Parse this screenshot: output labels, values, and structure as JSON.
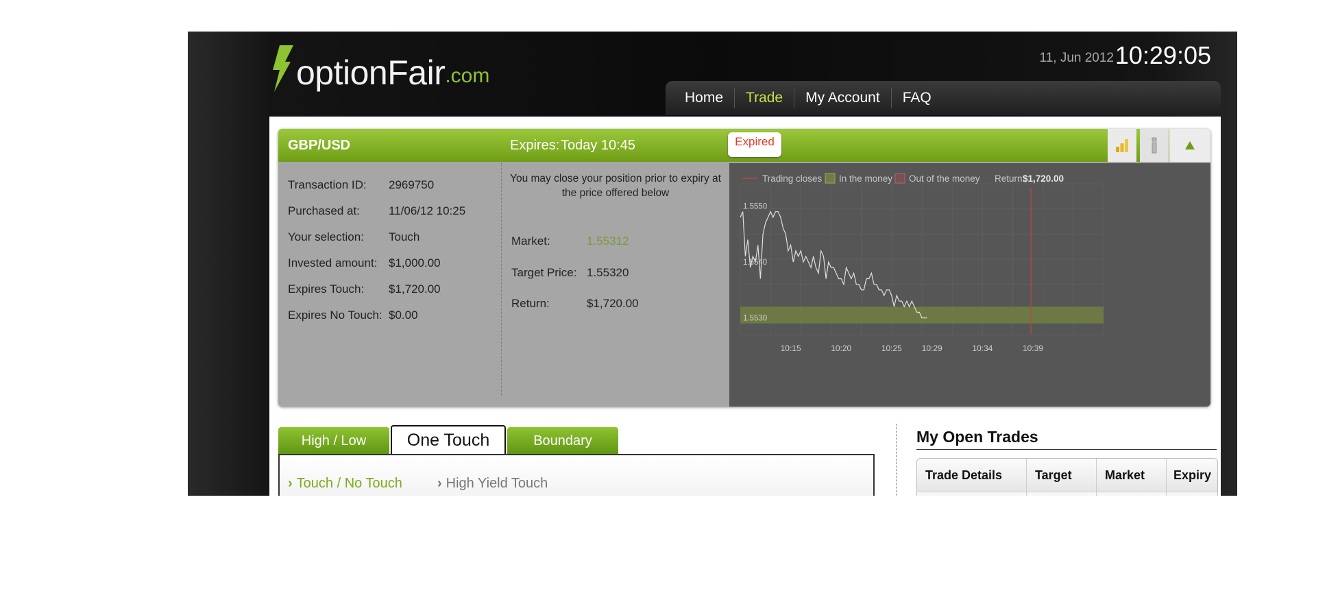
{
  "brand": {
    "logo_main": "optionFair",
    "logo_suffix": ".com",
    "accent": "#8ec332"
  },
  "header": {
    "date": "11, Jun 2012",
    "time": "10:29:05"
  },
  "nav": {
    "items": [
      "Home",
      "Trade",
      "My Account",
      "FAQ"
    ],
    "active": "Trade",
    "active_color": "#c4e04a"
  },
  "trade": {
    "asset": "GBP/USD",
    "expires_label": "Expires:",
    "expires_value": "Today 10:45",
    "status_badge": "Expired",
    "details": [
      {
        "label": "Transaction ID:",
        "value": "2969750"
      },
      {
        "label": "Purchased at:",
        "value": "11/06/12 10:25"
      },
      {
        "label": "Your selection:",
        "value": "Touch"
      },
      {
        "label": "Invested amount:",
        "value": "$1,000.00"
      },
      {
        "label": "Expires Touch:",
        "value": "$1,720.00"
      },
      {
        "label": "Expires No Touch:",
        "value": "$0.00"
      }
    ],
    "close_message": "You may close your position prior to expiry at the price offered below",
    "market_label": "Market:",
    "market_value": "1.55312",
    "target_label": "Target Price:",
    "target_value": "1.55320",
    "return_label": "Return:",
    "return_value": "$1,720.00"
  },
  "chart_data": {
    "type": "line",
    "legend": [
      "Trading closes",
      "In the money",
      "Out of the money"
    ],
    "return_label": "Return:",
    "return_value": "$1,720.00",
    "y_ticks": [
      "1.5550",
      "1.5540",
      "1.5530"
    ],
    "x_ticks": [
      "10:15",
      "10:20",
      "10:25",
      "10:29",
      "10:34",
      "10:39"
    ],
    "x_minutes": [
      15,
      20,
      25,
      29,
      34,
      39
    ],
    "ylim": [
      1.5527,
      1.5554
    ],
    "xlim": [
      10,
      46
    ],
    "band_range": [
      1.5529,
      1.5532
    ],
    "trading_closes_minute": 38.8,
    "series": [
      {
        "x": [
          10.0,
          10.25,
          10.5,
          10.75,
          11.0,
          11.25,
          11.5,
          11.75,
          12.0,
          12.25,
          12.5,
          12.75,
          13.0,
          13.25,
          13.5,
          13.75,
          14.0,
          14.25,
          14.5,
          14.75,
          15.0,
          15.25,
          15.5,
          15.75,
          16.0,
          16.25,
          16.5,
          16.75,
          17.0,
          17.25,
          17.5,
          17.75,
          18.0,
          18.25,
          18.5,
          18.75,
          19.0,
          19.25,
          19.5,
          19.75,
          20.0,
          20.25,
          20.5,
          20.75,
          21.0,
          21.25,
          21.5,
          21.75,
          22.0,
          22.25,
          22.5,
          22.75,
          23.0,
          23.25,
          23.5,
          23.75,
          24.0,
          24.25,
          24.5,
          24.75,
          25.0,
          25.25,
          25.5,
          25.75,
          26.0,
          26.25,
          26.5,
          26.75,
          27.0,
          27.25,
          27.5,
          27.75,
          28.0,
          28.25,
          28.5
        ],
        "y": [
          1.5548,
          1.5549,
          1.5541,
          1.5544,
          1.5539,
          1.5541,
          1.554,
          1.5543,
          1.5537,
          1.5545,
          1.5547,
          1.5548,
          1.5549,
          1.5548,
          1.5549,
          1.5549,
          1.5548,
          1.5546,
          1.5545,
          1.5542,
          1.5543,
          1.554,
          1.5542,
          1.5541,
          1.5542,
          1.554,
          1.5541,
          1.554,
          1.5539,
          1.5541,
          1.5539,
          1.5538,
          1.5542,
          1.5541,
          1.5537,
          1.554,
          1.5539,
          1.5539,
          1.5538,
          1.5537,
          1.5537,
          1.5536,
          1.5539,
          1.5538,
          1.5537,
          1.5538,
          1.5536,
          1.5536,
          1.5535,
          1.5535,
          1.5537,
          1.5537,
          1.5538,
          1.5536,
          1.5536,
          1.5535,
          1.5535,
          1.5534,
          1.5535,
          1.5535,
          1.5534,
          1.5532,
          1.5534,
          1.5533,
          1.5533,
          1.5532,
          1.5533,
          1.5532,
          1.5533,
          1.5532,
          1.5531,
          1.5531,
          1.553,
          1.553,
          1.553
        ]
      }
    ]
  },
  "tabs": {
    "items": [
      "High / Low",
      "One Touch",
      "Boundary"
    ],
    "active": "One Touch"
  },
  "subtabs": {
    "items": [
      "Touch / No Touch",
      "High Yield Touch"
    ],
    "active": "Touch / No Touch",
    "arrow": "›"
  },
  "open_trades": {
    "title": "My Open Trades",
    "columns": [
      "Trade Details",
      "Target",
      "Market",
      "Expiry"
    ]
  },
  "icons": {
    "chart": "bar-chart-icon",
    "info": "info-icon",
    "collapse": "triangle-up-icon"
  }
}
